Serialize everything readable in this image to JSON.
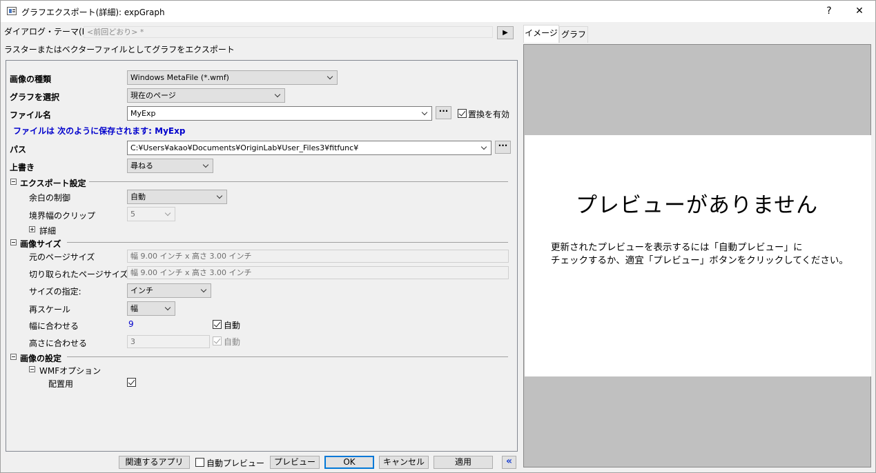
{
  "window": {
    "title": "グラフエクスポート(詳細): expGraph",
    "help_label": "?",
    "close_label": "✕"
  },
  "theme": {
    "label": "ダイアログ・テーマ(H)",
    "value": "<前回どおり> *",
    "arrow_label": "▶"
  },
  "description": "ラスターまたはベクターファイルとしてグラフをエクスポート",
  "form": {
    "image_type_label": "画像の種類",
    "image_type_value": "Windows MetaFile (*.wmf)",
    "select_graph_label": "グラフを選択",
    "select_graph_value": "現在のページ",
    "filename_label": "ファイル名",
    "filename_value": "MyExp",
    "browse_label": "···",
    "replace_label": "置換を有効",
    "saved_as_text": "ファイルは 次のように保存されます: MyExp",
    "path_label": "パス",
    "path_value": "C:¥Users¥akao¥Documents¥OriginLab¥User_Files3¥fitfunc¥",
    "overwrite_label": "上書き",
    "overwrite_value": "尋ねる"
  },
  "export_settings": {
    "header": "エクスポート設定",
    "margin_label": "余白の制御",
    "margin_value": "自動",
    "clip_label": "境界幅のクリップ",
    "clip_value": "5",
    "detail_label": "詳細"
  },
  "image_size": {
    "header": "画像サイズ",
    "original_label": "元のページサイズ",
    "original_value": "幅 9.00 インチ x 高さ 3.00 インチ",
    "cropped_label": "切り取られたページサイズ",
    "cropped_value": "幅 9.00 インチ x 高さ 3.00 インチ",
    "size_unit_label": "サイズの指定:",
    "size_unit_value": "インチ",
    "rescale_label": "再スケール",
    "rescale_value": "幅",
    "fit_width_label": "幅に合わせる",
    "fit_width_value": "9",
    "fit_width_auto": "自動",
    "fit_height_label": "高さに合わせる",
    "fit_height_value": "3",
    "fit_height_auto": "自動"
  },
  "image_settings": {
    "header": "画像の設定",
    "wmf_label": "WMFオプション",
    "placement_label": "配置用"
  },
  "buttons": {
    "related_apps": "関連するアプリ",
    "auto_preview": "自動プレビュー",
    "preview": "プレビュー",
    "ok": "OK",
    "cancel": "キャンセル",
    "apply": "適用",
    "collapse": "«"
  },
  "tabs": {
    "image": "イメージ",
    "graph": "グラフ"
  },
  "preview": {
    "no_preview": "プレビューがありません",
    "hint_line1": "更新されたプレビューを表示するには「自動プレビュー」に",
    "hint_line2": "チェックするか、適宜「プレビュー」ボタンをクリックしてください。"
  },
  "colors": {
    "link_blue": "#0000cc",
    "preview_gray": "#c0c0c0",
    "accent": "#0078d7"
  }
}
